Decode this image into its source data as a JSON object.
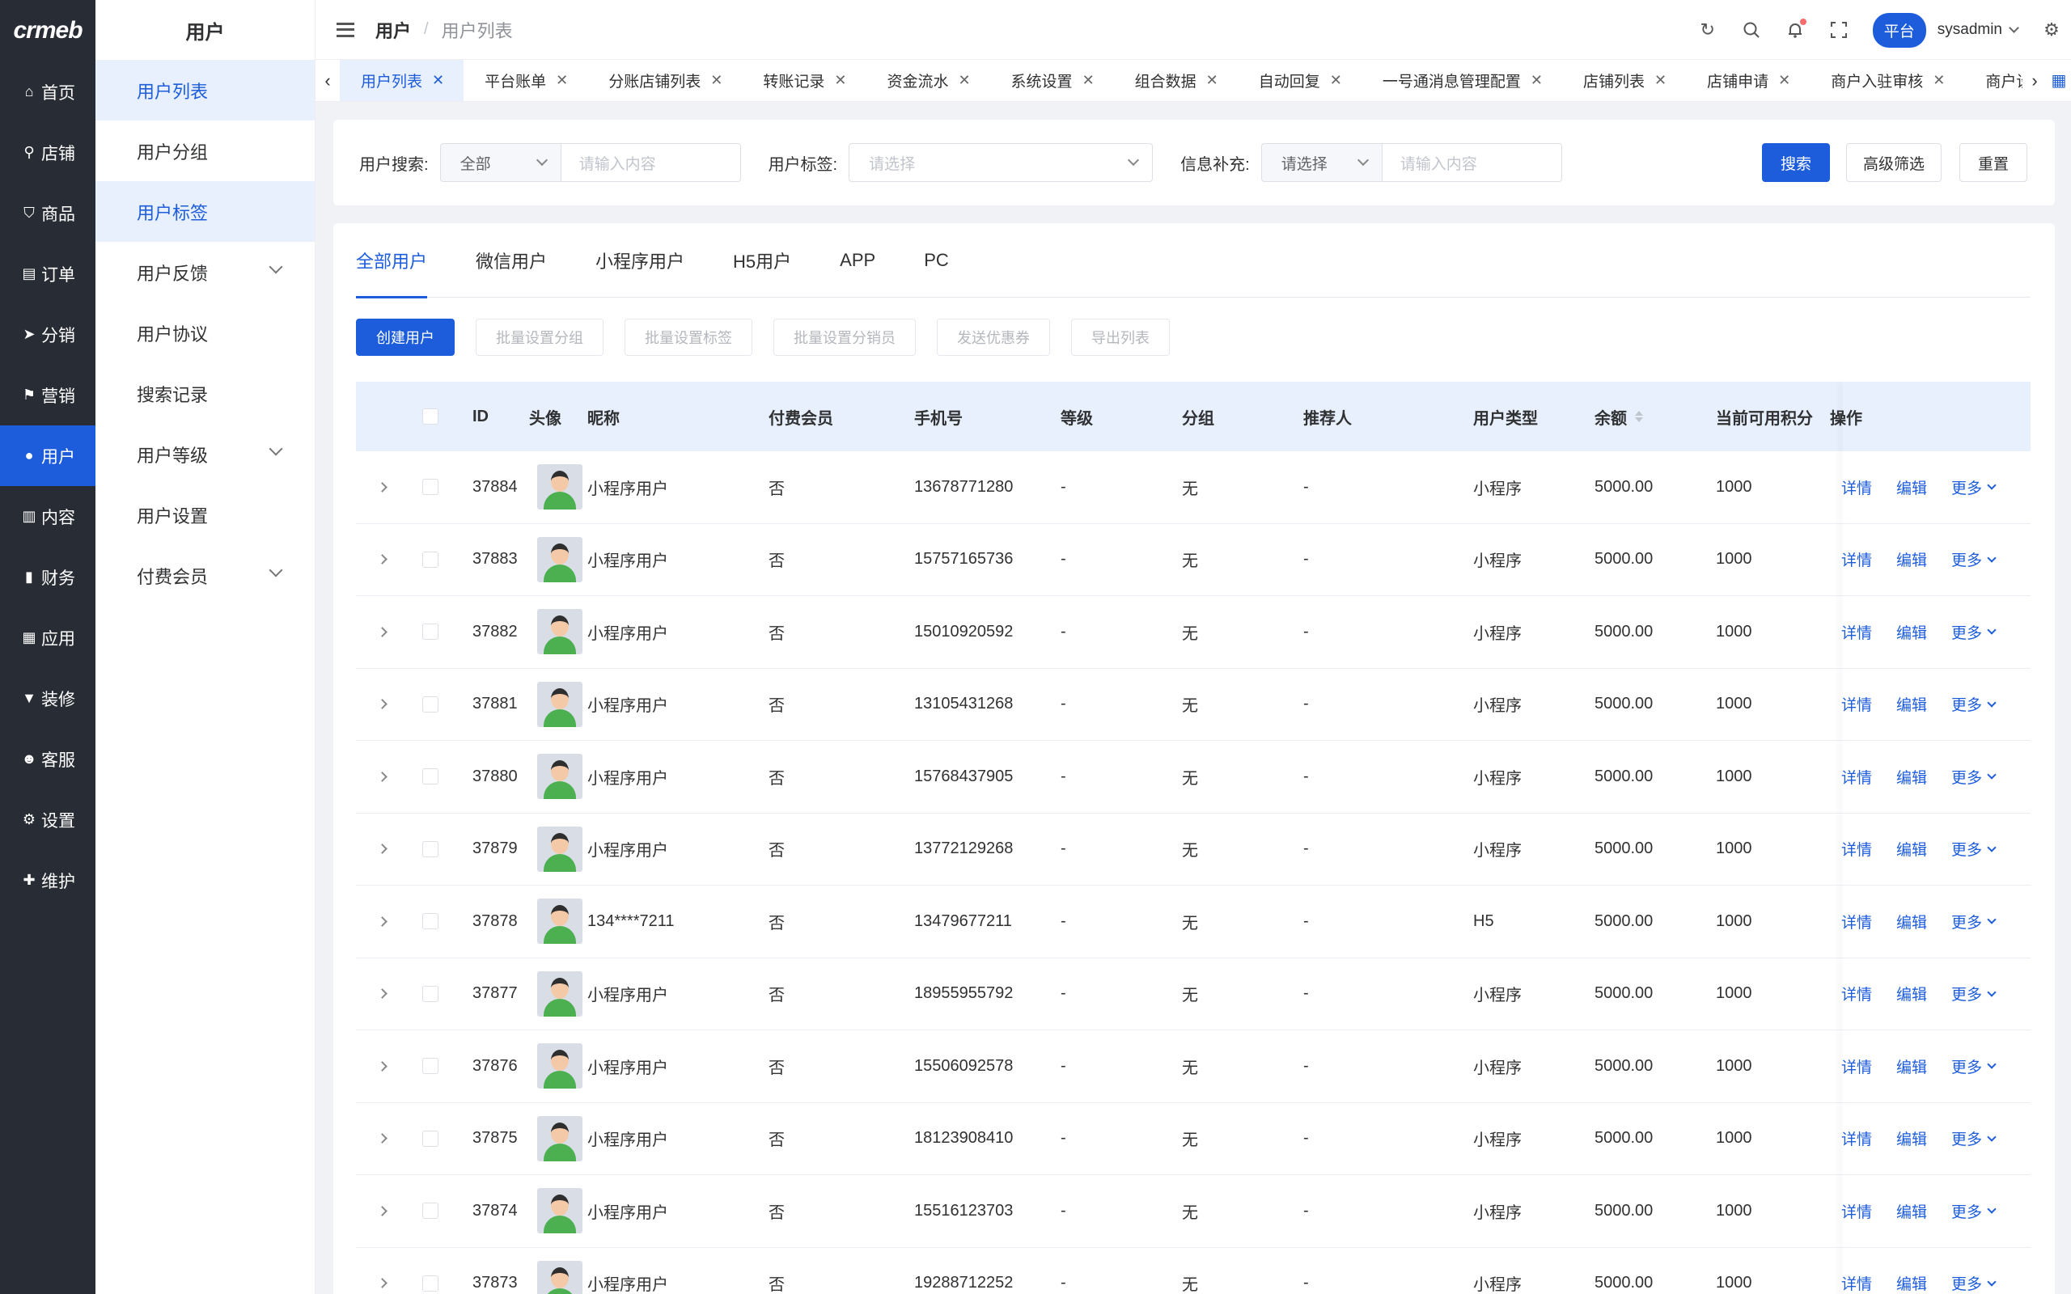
{
  "logo": "crmeb",
  "rail": [
    {
      "icon": "home-icon",
      "glyph": "⌂",
      "label": "首页"
    },
    {
      "icon": "store-icon",
      "glyph": "⚲",
      "label": "店铺"
    },
    {
      "icon": "goods-icon",
      "glyph": "⛉",
      "label": "商品"
    },
    {
      "icon": "order-icon",
      "glyph": "▤",
      "label": "订单"
    },
    {
      "icon": "distribution-icon",
      "glyph": "➤",
      "label": "分销"
    },
    {
      "icon": "marketing-icon",
      "glyph": "⚑",
      "label": "营销"
    },
    {
      "icon": "user-icon",
      "glyph": "●",
      "label": "用户"
    },
    {
      "icon": "content-icon",
      "glyph": "▥",
      "label": "内容"
    },
    {
      "icon": "finance-icon",
      "glyph": "▮",
      "label": "财务"
    },
    {
      "icon": "apps-icon",
      "glyph": "▦",
      "label": "应用"
    },
    {
      "icon": "decor-icon",
      "glyph": "▼",
      "label": "装修"
    },
    {
      "icon": "service-icon",
      "glyph": "☻",
      "label": "客服"
    },
    {
      "icon": "settings-icon",
      "glyph": "⚙",
      "label": "设置"
    },
    {
      "icon": "maintain-icon",
      "glyph": "✚",
      "label": "维护"
    }
  ],
  "submenu": {
    "title": "用户",
    "items": [
      {
        "label": "用户列表"
      },
      {
        "label": "用户分组"
      },
      {
        "label": "用户标签"
      },
      {
        "label": "用户反馈"
      },
      {
        "label": "用户协议"
      },
      {
        "label": "搜索记录"
      },
      {
        "label": "用户等级"
      },
      {
        "label": "用户设置"
      },
      {
        "label": "付费会员"
      }
    ]
  },
  "header": {
    "crumb1": "用户",
    "crumb_sep": "/",
    "crumb2": "用户列表",
    "platform": "平台",
    "user": "sysadmin"
  },
  "tags": [
    "用户列表",
    "平台账单",
    "分账店铺列表",
    "转账记录",
    "资金流水",
    "系统设置",
    "组合数据",
    "自动回复",
    "一号通消息管理配置",
    "店铺列表",
    "店铺申请",
    "商户入驻审核",
    "商户设"
  ],
  "search": {
    "label1": "用户搜索:",
    "select1": "全部",
    "input1_placeholder": "请输入内容",
    "label2": "用户标签:",
    "select2": "请选择",
    "label3": "信息补充:",
    "select3": "请选择",
    "input3_placeholder": "请输入内容",
    "search_btn": "搜索",
    "advanced_btn": "高级筛选",
    "reset_btn": "重置"
  },
  "user_tabs": [
    "全部用户",
    "微信用户",
    "小程序用户",
    "H5用户",
    "APP",
    "PC"
  ],
  "actions": [
    "创建用户",
    "批量设置分组",
    "批量设置标签",
    "批量设置分销员",
    "发送优惠券",
    "导出列表"
  ],
  "columns": {
    "id": "ID",
    "avatar": "头像",
    "nickname": "昵称",
    "vip": "付费会员",
    "phone": "手机号",
    "level": "等级",
    "group": "分组",
    "referrer": "推荐人",
    "type": "用户类型",
    "balance": "余额",
    "points": "当前可用积分",
    "ops": "操作"
  },
  "ops": {
    "detail": "详情",
    "edit": "编辑",
    "more": "更多"
  },
  "rows": [
    {
      "id": "37884",
      "nickname": "小程序用户",
      "vip": "否",
      "phone": "13678771280",
      "level": "-",
      "group": "无",
      "referrer": "-",
      "type": "小程序",
      "balance": "5000.00",
      "points": "1000"
    },
    {
      "id": "37883",
      "nickname": "小程序用户",
      "vip": "否",
      "phone": "15757165736",
      "level": "-",
      "group": "无",
      "referrer": "-",
      "type": "小程序",
      "balance": "5000.00",
      "points": "1000"
    },
    {
      "id": "37882",
      "nickname": "小程序用户",
      "vip": "否",
      "phone": "15010920592",
      "level": "-",
      "group": "无",
      "referrer": "-",
      "type": "小程序",
      "balance": "5000.00",
      "points": "1000"
    },
    {
      "id": "37881",
      "nickname": "小程序用户",
      "vip": "否",
      "phone": "13105431268",
      "level": "-",
      "group": "无",
      "referrer": "-",
      "type": "小程序",
      "balance": "5000.00",
      "points": "1000"
    },
    {
      "id": "37880",
      "nickname": "小程序用户",
      "vip": "否",
      "phone": "15768437905",
      "level": "-",
      "group": "无",
      "referrer": "-",
      "type": "小程序",
      "balance": "5000.00",
      "points": "1000"
    },
    {
      "id": "37879",
      "nickname": "小程序用户",
      "vip": "否",
      "phone": "13772129268",
      "level": "-",
      "group": "无",
      "referrer": "-",
      "type": "小程序",
      "balance": "5000.00",
      "points": "1000"
    },
    {
      "id": "37878",
      "nickname": "134****7211",
      "vip": "否",
      "phone": "13479677211",
      "level": "-",
      "group": "无",
      "referrer": "-",
      "type": "H5",
      "balance": "5000.00",
      "points": "1000"
    },
    {
      "id": "37877",
      "nickname": "小程序用户",
      "vip": "否",
      "phone": "18955955792",
      "level": "-",
      "group": "无",
      "referrer": "-",
      "type": "小程序",
      "balance": "5000.00",
      "points": "1000"
    },
    {
      "id": "37876",
      "nickname": "小程序用户",
      "vip": "否",
      "phone": "15506092578",
      "level": "-",
      "group": "无",
      "referrer": "-",
      "type": "小程序",
      "balance": "5000.00",
      "points": "1000"
    },
    {
      "id": "37875",
      "nickname": "小程序用户",
      "vip": "否",
      "phone": "18123908410",
      "level": "-",
      "group": "无",
      "referrer": "-",
      "type": "小程序",
      "balance": "5000.00",
      "points": "1000"
    },
    {
      "id": "37874",
      "nickname": "小程序用户",
      "vip": "否",
      "phone": "15516123703",
      "level": "-",
      "group": "无",
      "referrer": "-",
      "type": "小程序",
      "balance": "5000.00",
      "points": "1000"
    },
    {
      "id": "37873",
      "nickname": "小程序用户",
      "vip": "否",
      "phone": "19288712252",
      "level": "-",
      "group": "无",
      "referrer": "-",
      "type": "小程序",
      "balance": "5000.00",
      "points": "1000"
    }
  ],
  "colors": {
    "primary": "#1d5ddc",
    "rail_bg": "#282c34",
    "highlight_bg": "#e8f0fd"
  }
}
